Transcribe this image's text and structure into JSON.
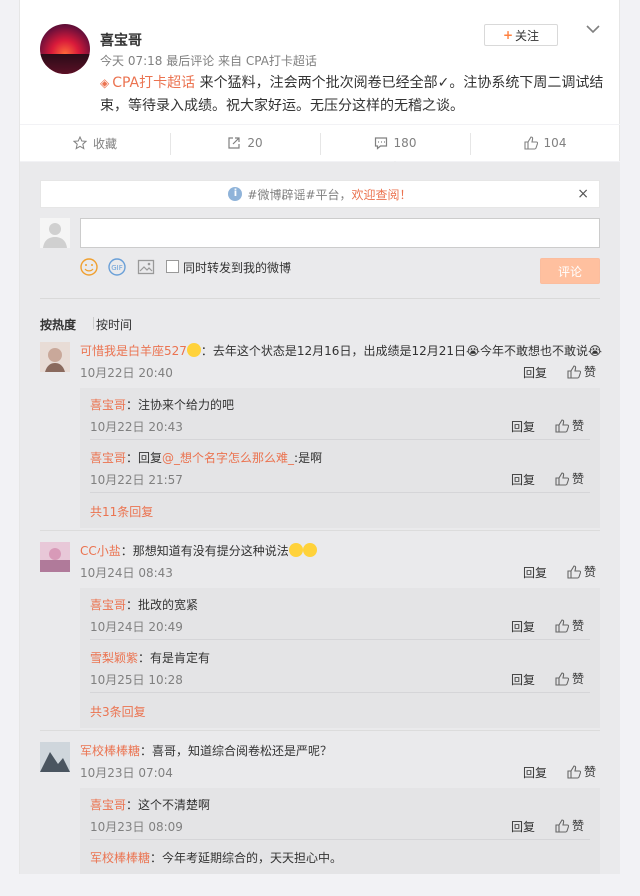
{
  "post": {
    "username": "喜宝哥",
    "meta": "今天 07:18 最后评论 来自 CPA打卡超话",
    "follow_label": "关注",
    "topic": "CPA打卡超话",
    "text": " 来个猛料，注会两个批次阅卷已经全部✓。注协系统下周二调试结束，等待录入成绩。祝大家好运。无压分这样的无稽之谈。"
  },
  "actions": {
    "favorite_label": "收藏",
    "repost_count": "20",
    "comment_count": "180",
    "like_count": "104"
  },
  "notice": {
    "prefix": "#微博辟谣#平台，",
    "link": "欢迎查阅！",
    "close": "×"
  },
  "composer": {
    "repost_label": "同时转发到我的微博",
    "submit_label": "评论"
  },
  "sort": {
    "hot": "按热度",
    "time": "按时间"
  },
  "labels": {
    "reply": "回复",
    "like": "赞"
  },
  "comments": [
    {
      "nick": "可惜我是白羊座527",
      "text": "：去年这个状态是12月16日，出成绩是12月21日😭今年不敢想也不敢说😭",
      "time": "10月22日 20:40",
      "replies": [
        {
          "nick": "喜宝哥",
          "text": "：注协来个给力的吧",
          "time": "10月22日 20:43"
        },
        {
          "nick": "喜宝哥",
          "pre": "：回复",
          "mention": "@_想个名字怎么那么难_",
          "text": ":是啊",
          "time": "10月22日 21:57"
        }
      ],
      "more": "共11条回复"
    },
    {
      "nick": "CC小盐",
      "text": "：那想知道有没有提分这种说法",
      "time": "10月24日 08:43",
      "replies": [
        {
          "nick": "喜宝哥",
          "text": "：批改的宽紧",
          "time": "10月24日 20:49"
        },
        {
          "nick": "雪梨颖紫",
          "text": "：有是肯定有",
          "time": "10月25日 10:28"
        }
      ],
      "more": "共3条回复"
    },
    {
      "nick": "军校棒棒糖",
      "text": "：喜哥，知道综合阅卷松还是严呢？",
      "time": "10月23日 07:04",
      "replies": [
        {
          "nick": "喜宝哥",
          "text": "：这个不清楚啊",
          "time": "10月23日 08:09"
        },
        {
          "nick": "军校棒棒糖",
          "text": "：今年考延期综合的，天天担心中。"
        }
      ]
    }
  ]
}
